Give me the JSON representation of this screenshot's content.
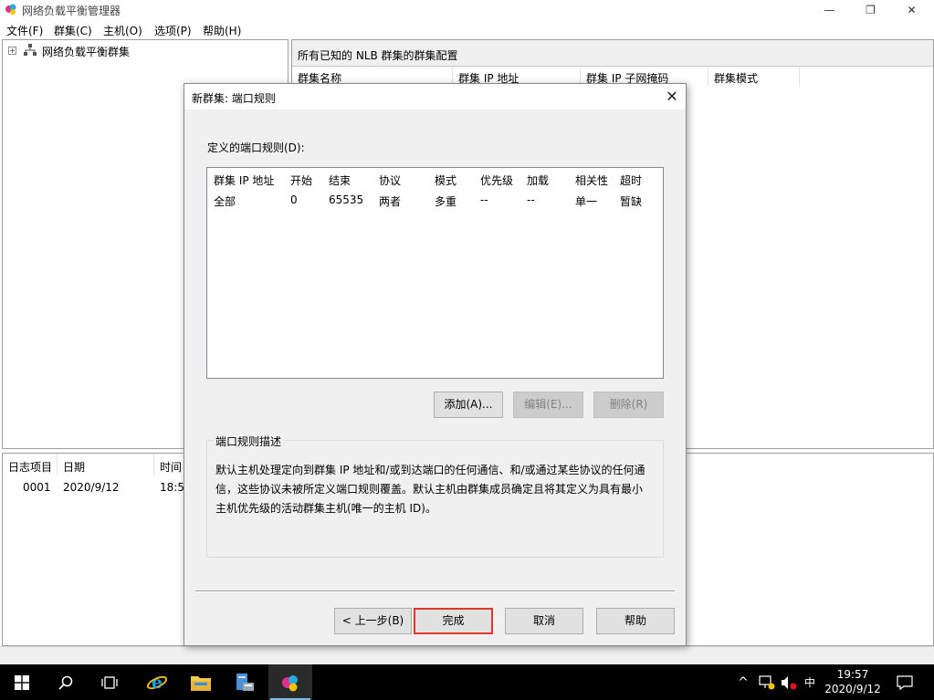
{
  "colors": {
    "window_bg": "#ffffff",
    "dialog_bg": "#f0f0f0",
    "default_button_border": "#e0362c",
    "taskbar_bg": "#000000",
    "accent": "#76b9ed"
  },
  "window": {
    "title": "网络负载平衡管理器",
    "controls": {
      "minimize": "—",
      "maximize": "❐",
      "close": "✕"
    }
  },
  "menu": [
    "文件(F)",
    "群集(C)",
    "主机(O)",
    "选项(P)",
    "帮助(H)"
  ],
  "tree": {
    "expander": "+",
    "root_label": "网络负载平衡群集",
    "root_icon": "network-cluster-icon"
  },
  "cluster_pane": {
    "title": "所有已知的 NLB 群集的群集配置",
    "columns": [
      "群集名称",
      "群集 IP 地址",
      "群集 IP 子网掩码",
      "群集模式"
    ]
  },
  "log_pane": {
    "columns": [
      "日志项目",
      "日期",
      "时间"
    ],
    "rows": [
      {
        "id": "0001",
        "date": "2020/9/12",
        "time": "18:5"
      }
    ]
  },
  "dialog": {
    "title": "新群集: 端口规则",
    "close": "✕",
    "defined_rules_label": "定义的端口规则(D):",
    "rules_columns": [
      "群集 IP 地址",
      "开始",
      "结束",
      "协议",
      "模式",
      "优先级",
      "加载",
      "相关性",
      "超时"
    ],
    "rules_rows": [
      [
        "全部",
        "0",
        "65535",
        "两者",
        "多重",
        "--",
        "--",
        "单一",
        "暂缺"
      ]
    ],
    "buttons": {
      "add": "添加(A)...",
      "edit": "编辑(E)...",
      "remove": "删除(R)",
      "back": "< 上一步(B)",
      "finish": "完成",
      "cancel": "取消",
      "help": "帮助"
    },
    "description_title": "端口规则描述",
    "description_lines": [
      "默认主机处理定向到群集 IP 地址和/或到达端口的任何通信、和/或通过某些协议的任何通",
      "信，这些协议未被所定义端口规则覆盖。默认主机由群集成员确定且将其定义为具有最小",
      "主机优先级的活动群集主机(唯一的主机 ID)。"
    ]
  },
  "taskbar": {
    "items": [
      "windows-start-icon",
      "search-icon",
      "task-view-icon",
      "internet-explorer-icon",
      "file-explorer-icon",
      "server-manager-icon",
      "nlb-manager-icon"
    ],
    "tray": {
      "chevron": "^",
      "ime": "中"
    },
    "clock": {
      "time": "19:57",
      "date": "2020/9/12"
    }
  }
}
